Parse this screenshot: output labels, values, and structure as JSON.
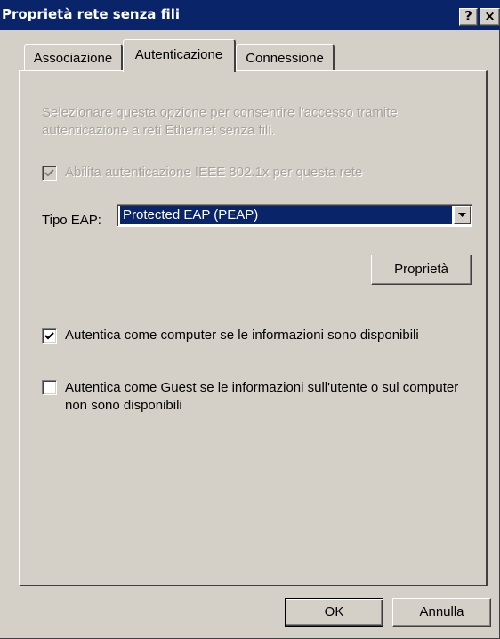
{
  "window": {
    "title": "Proprietà rete senza fili",
    "help_button": "?",
    "close_button": "×"
  },
  "tabs": [
    {
      "label": "Associazione",
      "selected": false
    },
    {
      "label": "Autenticazione",
      "selected": true
    },
    {
      "label": "Connessione",
      "selected": false
    }
  ],
  "auth": {
    "description": "Selezionare questa opzione per consentire l'accesso tramite autenticazione a reti Ethernet senza fili.",
    "ieee_checkbox": {
      "label": "Abilita autenticazione IEEE 802.1x per questa rete",
      "checked": true,
      "enabled": false
    },
    "eap_label": "Tipo EAP:",
    "eap_selected": "Protected EAP (PEAP)",
    "properties_button": "Proprietà",
    "computer_checkbox": {
      "label": "Autentica come computer se le informazioni sono disponibili",
      "checked": true
    },
    "guest_checkbox": {
      "label": "Autentica come Guest se le informazioni sull'utente o sul computer non sono disponibili",
      "checked": false
    }
  },
  "footer": {
    "ok_label": "OK",
    "cancel_label": "Annulla"
  },
  "colors": {
    "titlebar": "#0a246a",
    "face": "#d4d0c8",
    "selection": "#0a246a"
  }
}
